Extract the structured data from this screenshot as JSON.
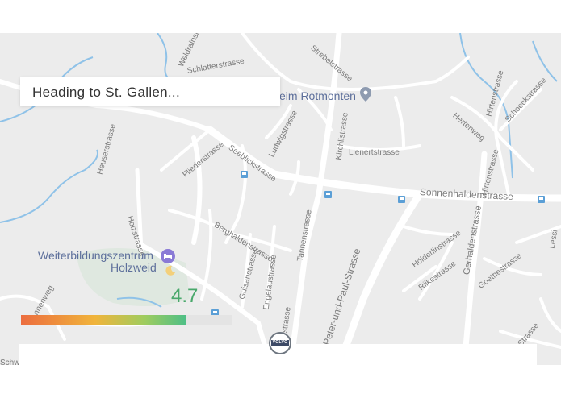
{
  "navigation": {
    "heading": "Heading to St. Gallen..."
  },
  "map": {
    "streets": {
      "weldrainstrasse": "Weldrainstrasse",
      "schlatterstrasse": "Schlatterstrasse",
      "strebelstrasse": "Strebelstrasse",
      "heuserstrasse": "Heuserstrasse",
      "fliederstrasse": "Fliederstrasse",
      "seeblickstrasse": "Seeblickstrasse",
      "ludwigstrasse": "Ludwigstrasse",
      "kirchlistrasse": "Kirchlistrasse",
      "lienertstrasse": "Lienertstrasse",
      "hertenweg": "Hertenweg",
      "hirtenstrasse_top": "Hirtenstrasse",
      "schoeckstrasse": "Schoeckstrasse",
      "hirtenstrasse": "Hirtenstrasse",
      "sonnenhaldenstrasse": "Sonnenhaldenstrasse",
      "holzstrasse": "Holzstrasse",
      "berghaldenstrasse": "Berghaldenstrasse",
      "tannenstrasse": "Tannenstrasse",
      "gerhaldenstrasse": "Gerhaldenstrasse",
      "hoelderlinstrasse": "Hölderlinstrasse",
      "rilkestrasse": "Rilkestrasse",
      "goethestrasse": "Goethestrasse",
      "guisanstrasse": "Guisanstrasse",
      "engelaustrasse": "Engelaustrasse",
      "peter_paul_strasse": "Peter-und-Paul-Strasse",
      "strasse_bottom": "Strasse",
      "nnenweg": "nnenweg",
      "nstrasse": "nstrasse",
      "lessing": "Lessi",
      "schw": "Schw"
    },
    "pois": {
      "rotmonten": "eim Rotmonten",
      "weiterbildung_line1": "Weiterbildungszentrum",
      "weiterbildung_line2": "Holzweid"
    },
    "colors": {
      "background": "#ececec",
      "road": "#ffffff",
      "water": "#8fc2e8",
      "transit": "#5b9fd6",
      "poi_text": "#5d6f9b"
    }
  },
  "rating": {
    "value": "4.7",
    "level_fraction": 0.78,
    "gradient": [
      "#ec6d3f",
      "#f0b43b",
      "#9fcc5f",
      "#4fbf86"
    ]
  },
  "brand": {
    "badge_text": "VOLVO"
  }
}
